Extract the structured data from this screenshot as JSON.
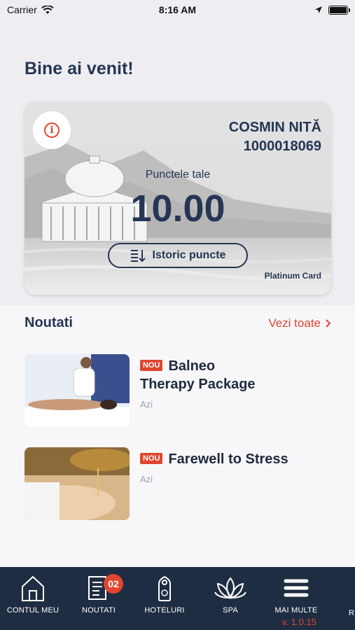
{
  "status_bar": {
    "carrier": "Carrier",
    "time": "8:16 AM"
  },
  "header": {
    "welcome": "Bine ai venit!"
  },
  "card": {
    "name": "COSMIN NITĂ",
    "number": "1000018069",
    "points_label": "Punctele tale",
    "points_value": "10.00",
    "history_button": "Istoric puncte",
    "card_type": "Platinum Card"
  },
  "news": {
    "title": "Noutati",
    "see_all": "Vezi toate",
    "items": [
      {
        "badge": "NOU",
        "title_line1": "Balneo",
        "title_line2": "Therapy Package",
        "date": "Azi"
      },
      {
        "badge": "NOU",
        "title_line1": "Farewell to Stress",
        "date": "Azi"
      }
    ]
  },
  "tabs": [
    {
      "label": "CONTUL MEU",
      "icon": "house-icon"
    },
    {
      "label": "NOUTATI",
      "icon": "news-icon",
      "badge": "02"
    },
    {
      "label": "HOTELURI",
      "icon": "door-hanger-icon"
    },
    {
      "label": "SPA",
      "icon": "lotus-icon"
    },
    {
      "label": "MAI MULTE",
      "icon": "menu-icon"
    }
  ],
  "tab_partial": "R",
  "version": "v. 1.0.15",
  "colors": {
    "accent": "#e0452f",
    "navy": "#263554",
    "tab_bg": "#1f2d42"
  }
}
